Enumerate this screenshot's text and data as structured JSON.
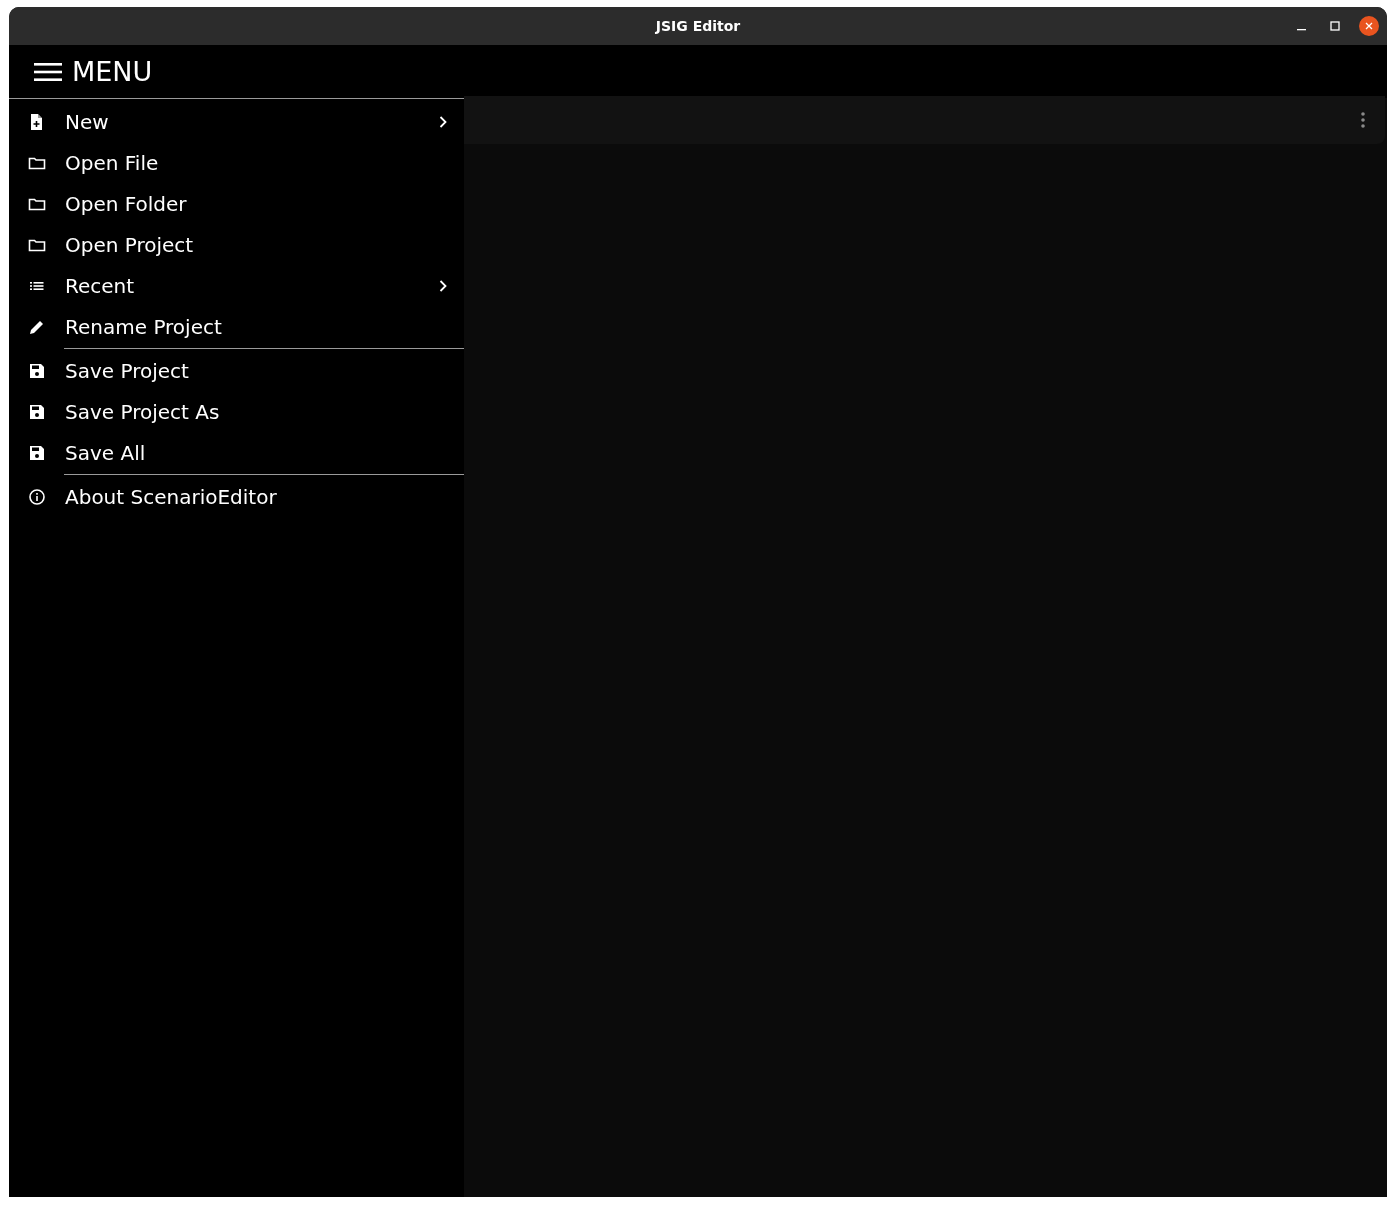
{
  "window": {
    "title": "JSIG Editor"
  },
  "header": {
    "title": "MENU"
  },
  "menu_groups": [
    [
      {
        "label": "New",
        "submenu": true
      },
      {
        "label": "Open File",
        "submenu": false
      },
      {
        "label": "Open Folder",
        "submenu": false
      },
      {
        "label": "Open Project",
        "submenu": false
      },
      {
        "label": "Recent",
        "submenu": true
      },
      {
        "label": "Rename Project",
        "submenu": false
      }
    ],
    [
      {
        "label": "Save Project",
        "submenu": false
      },
      {
        "label": "Save Project As",
        "submenu": false
      },
      {
        "label": "Save All",
        "submenu": false
      }
    ],
    [
      {
        "label": "About ScenarioEditor",
        "submenu": false
      }
    ]
  ]
}
